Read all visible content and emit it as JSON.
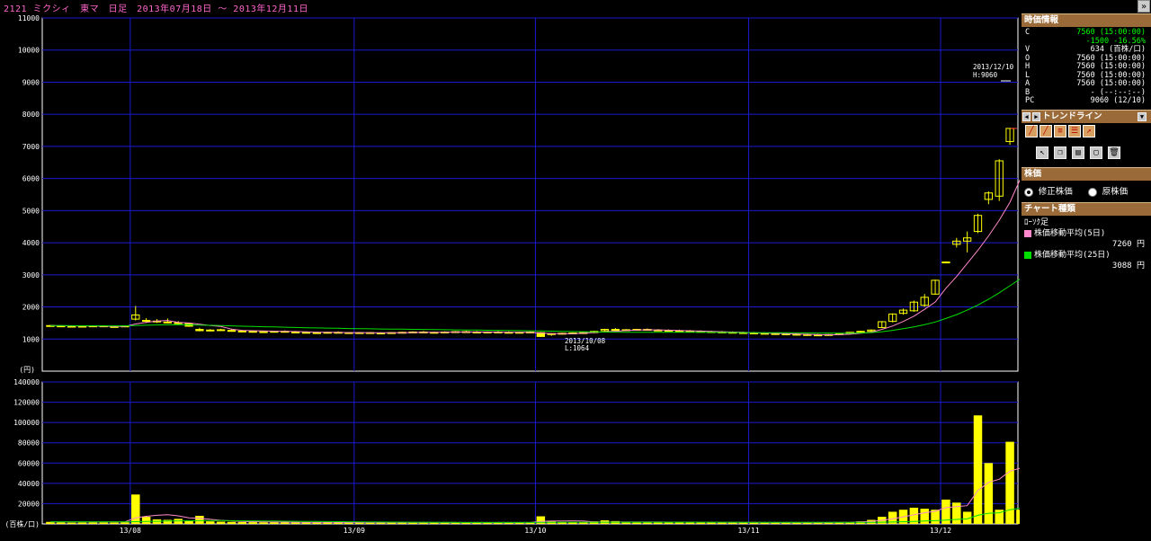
{
  "header": {
    "title": "2121 ミクシィ　東マ　日足　2013年07月18日 ～ 2013年12月11日",
    "collapse_icon": "double-chevron-right-icon"
  },
  "annotations": {
    "high_label_date": "2013/12/10",
    "high_label_value": "H:9060",
    "low_label_date": "2013/10/08",
    "low_label_value": "L:1064"
  },
  "price_axis": {
    "unit_label": "(円)"
  },
  "volume_axis": {
    "unit_label": "(百株/口)"
  },
  "colors": {
    "grid": "#1a1ad0",
    "axis": "#ffffff",
    "candle": "#ffff00",
    "ma5": "#ff88cc",
    "ma25": "#00e000",
    "panel_header": "#9a6a38",
    "price_up_text": "#00ff00"
  },
  "side_panel": {
    "quote_title": "時価情報",
    "quote_rows": [
      {
        "key": "C",
        "value": "7560 (15:00:00)"
      },
      {
        "key": "",
        "value": "-1500 -16.56%"
      },
      {
        "key": "V",
        "value": "634 (百株/口)"
      },
      {
        "key": "O",
        "value": "7560 (15:00:00)"
      },
      {
        "key": "H",
        "value": "7560 (15:00:00)"
      },
      {
        "key": "L",
        "value": "7560 (15:00:00)"
      },
      {
        "key": "A",
        "value": "7560 (15:00:00)"
      },
      {
        "key": "B",
        "value": "- (--:--:--)"
      },
      {
        "key": "PC",
        "value": "9060 (12/10)"
      }
    ],
    "trendline_title": "トレンドライン",
    "stock_price_title": "株価",
    "adjusted_label": "修正株価",
    "original_label": "原株価",
    "chart_type_title": "チャート種類",
    "chart_type_value": "ﾛｰｿｸ足",
    "ma5_label": "株価移動平均(5日)",
    "ma5_value": "7260 円",
    "ma25_label": "株価移動平均(25日)",
    "ma25_value": "3088 円"
  },
  "chart_data": [
    {
      "type": "candlestick",
      "title": "2121 ミクシィ　東マ　日足　2013年07月18日 ～ 2013年12月11日",
      "ylabel": "(円)",
      "ylim": [
        0,
        11000
      ],
      "y_ticks": [
        1000,
        2000,
        3000,
        4000,
        5000,
        6000,
        7000,
        8000,
        9000,
        10000,
        11000
      ],
      "x_tick_labels": [
        "13/08",
        "13/09",
        "13/10",
        "13/11",
        "13/12"
      ],
      "x_tick_index": [
        8,
        29,
        46,
        66,
        84
      ],
      "grid": true,
      "ohlc": [
        [
          1420,
          1440,
          1400,
          1420
        ],
        [
          1410,
          1430,
          1390,
          1400
        ],
        [
          1400,
          1420,
          1380,
          1390
        ],
        [
          1390,
          1410,
          1370,
          1400
        ],
        [
          1400,
          1420,
          1380,
          1410
        ],
        [
          1410,
          1430,
          1380,
          1390
        ],
        [
          1390,
          1410,
          1370,
          1380
        ],
        [
          1380,
          1420,
          1370,
          1410
        ],
        [
          1620,
          2030,
          1580,
          1750
        ],
        [
          1560,
          1650,
          1500,
          1580
        ],
        [
          1540,
          1620,
          1500,
          1560
        ],
        [
          1520,
          1640,
          1490,
          1530
        ],
        [
          1510,
          1560,
          1430,
          1480
        ],
        [
          1480,
          1500,
          1380,
          1400
        ],
        [
          1300,
          1350,
          1240,
          1260
        ],
        [
          1270,
          1310,
          1240,
          1280
        ],
        [
          1290,
          1320,
          1250,
          1270
        ],
        [
          1270,
          1300,
          1230,
          1240
        ],
        [
          1240,
          1280,
          1210,
          1250
        ],
        [
          1240,
          1270,
          1200,
          1220
        ],
        [
          1220,
          1260,
          1190,
          1230
        ],
        [
          1230,
          1260,
          1200,
          1240
        ],
        [
          1240,
          1270,
          1210,
          1220
        ],
        [
          1220,
          1250,
          1190,
          1210
        ],
        [
          1210,
          1240,
          1180,
          1200
        ],
        [
          1200,
          1230,
          1170,
          1190
        ],
        [
          1190,
          1230,
          1170,
          1210
        ],
        [
          1210,
          1240,
          1180,
          1200
        ],
        [
          1200,
          1220,
          1170,
          1190
        ],
        [
          1190,
          1220,
          1170,
          1200
        ],
        [
          1200,
          1220,
          1170,
          1180
        ],
        [
          1180,
          1210,
          1160,
          1190
        ],
        [
          1190,
          1220,
          1170,
          1200
        ],
        [
          1200,
          1230,
          1180,
          1210
        ],
        [
          1210,
          1240,
          1190,
          1220
        ],
        [
          1220,
          1250,
          1190,
          1200
        ],
        [
          1200,
          1230,
          1180,
          1210
        ],
        [
          1210,
          1240,
          1190,
          1220
        ],
        [
          1220,
          1250,
          1200,
          1230
        ],
        [
          1230,
          1260,
          1200,
          1220
        ],
        [
          1220,
          1250,
          1190,
          1210
        ],
        [
          1210,
          1240,
          1190,
          1220
        ],
        [
          1220,
          1250,
          1200,
          1210
        ],
        [
          1210,
          1240,
          1180,
          1200
        ],
        [
          1200,
          1230,
          1180,
          1210
        ],
        [
          1210,
          1240,
          1190,
          1220
        ],
        [
          1200,
          1220,
          1064,
          1080
        ],
        [
          1140,
          1190,
          1100,
          1170
        ],
        [
          1170,
          1200,
          1140,
          1180
        ],
        [
          1180,
          1210,
          1150,
          1190
        ],
        [
          1190,
          1220,
          1160,
          1200
        ],
        [
          1200,
          1260,
          1180,
          1240
        ],
        [
          1260,
          1320,
          1240,
          1300
        ],
        [
          1300,
          1340,
          1260,
          1280
        ],
        [
          1280,
          1310,
          1250,
          1290
        ],
        [
          1290,
          1320,
          1260,
          1300
        ],
        [
          1300,
          1330,
          1260,
          1280
        ],
        [
          1280,
          1310,
          1250,
          1270
        ],
        [
          1270,
          1300,
          1240,
          1260
        ],
        [
          1260,
          1290,
          1230,
          1250
        ],
        [
          1250,
          1280,
          1220,
          1240
        ],
        [
          1240,
          1270,
          1210,
          1230
        ],
        [
          1230,
          1260,
          1200,
          1220
        ],
        [
          1220,
          1250,
          1190,
          1210
        ],
        [
          1210,
          1240,
          1180,
          1200
        ],
        [
          1200,
          1230,
          1170,
          1190
        ],
        [
          1190,
          1220,
          1160,
          1180
        ],
        [
          1180,
          1210,
          1150,
          1170
        ],
        [
          1170,
          1200,
          1130,
          1160
        ],
        [
          1160,
          1190,
          1120,
          1150
        ],
        [
          1150,
          1180,
          1110,
          1140
        ],
        [
          1140,
          1170,
          1100,
          1130
        ],
        [
          1130,
          1160,
          1090,
          1120
        ],
        [
          1120,
          1150,
          1100,
          1140
        ],
        [
          1140,
          1180,
          1120,
          1170
        ],
        [
          1170,
          1220,
          1150,
          1210
        ],
        [
          1210,
          1260,
          1180,
          1240
        ],
        [
          1240,
          1300,
          1200,
          1280
        ],
        [
          1360,
          1560,
          1340,
          1540
        ],
        [
          1550,
          1800,
          1520,
          1780
        ],
        [
          1800,
          1950,
          1760,
          1900
        ],
        [
          1880,
          2200,
          1850,
          2150
        ],
        [
          2050,
          2400,
          2000,
          2300
        ],
        [
          2400,
          2850,
          2380,
          2830
        ],
        [
          3380,
          3420,
          3360,
          3400
        ],
        [
          3950,
          4150,
          3850,
          4050
        ],
        [
          4050,
          4350,
          3700,
          4150
        ],
        [
          4350,
          4900,
          4300,
          4850
        ],
        [
          5350,
          5600,
          5200,
          5550
        ],
        [
          5450,
          6600,
          5300,
          6550
        ],
        [
          7150,
          7550,
          7050,
          7560
        ]
      ],
      "ma5": [
        1420,
        1415,
        1410,
        1405,
        1405,
        1400,
        1395,
        1395,
        1470,
        1520,
        1560,
        1580,
        1520,
        1500,
        1460,
        1420,
        1390,
        1310,
        1270,
        1260,
        1250,
        1245,
        1240,
        1235,
        1225,
        1215,
        1210,
        1205,
        1200,
        1200,
        1198,
        1196,
        1196,
        1198,
        1204,
        1206,
        1208,
        1212,
        1218,
        1220,
        1220,
        1218,
        1216,
        1212,
        1210,
        1212,
        1186,
        1174,
        1168,
        1164,
        1182,
        1204,
        1222,
        1242,
        1262,
        1282,
        1288,
        1286,
        1276,
        1268,
        1258,
        1248,
        1238,
        1228,
        1218,
        1208,
        1198,
        1188,
        1178,
        1168,
        1158,
        1148,
        1138,
        1132,
        1136,
        1150,
        1178,
        1212,
        1302,
        1404,
        1548,
        1714,
        1926,
        2154,
        2580,
        2946,
        3352,
        3766,
        4212,
        4700,
        5260,
        6000,
        7260
      ],
      "ma25": [
        1420,
        1418,
        1416,
        1414,
        1413,
        1412,
        1411,
        1410,
        1420,
        1430,
        1440,
        1445,
        1446,
        1442,
        1436,
        1428,
        1420,
        1410,
        1400,
        1392,
        1384,
        1376,
        1368,
        1360,
        1352,
        1346,
        1340,
        1334,
        1328,
        1322,
        1318,
        1314,
        1310,
        1306,
        1302,
        1298,
        1294,
        1290,
        1286,
        1282,
        1278,
        1274,
        1270,
        1266,
        1262,
        1258,
        1252,
        1246,
        1240,
        1234,
        1228,
        1222,
        1218,
        1214,
        1212,
        1210,
        1210,
        1210,
        1210,
        1210,
        1210,
        1210,
        1208,
        1206,
        1204,
        1202,
        1200,
        1198,
        1196,
        1194,
        1192,
        1190,
        1188,
        1186,
        1184,
        1182,
        1190,
        1200,
        1230,
        1270,
        1320,
        1380,
        1450,
        1530,
        1640,
        1760,
        1900,
        2060,
        2240,
        2440,
        2660,
        2880,
        3088
      ]
    },
    {
      "type": "bar",
      "ylabel": "(百株/口)",
      "ylim": [
        0,
        140000
      ],
      "y_ticks": [
        20000,
        40000,
        60000,
        80000,
        100000,
        120000,
        140000
      ],
      "x_tick_labels": [
        "13/08",
        "13/09",
        "13/10",
        "13/11",
        "13/12"
      ],
      "grid": true,
      "values": [
        2000,
        1500,
        1200,
        1300,
        1500,
        1400,
        1300,
        1600,
        29000,
        7000,
        4500,
        4000,
        5000,
        3500,
        8000,
        2500,
        2200,
        2000,
        1800,
        1700,
        1600,
        1700,
        1500,
        1400,
        1500,
        1300,
        1400,
        1500,
        1300,
        1400,
        1200,
        1300,
        1400,
        1300,
        1200,
        1300,
        1400,
        1300,
        1200,
        1300,
        1400,
        1300,
        1200,
        1300,
        1400,
        1300,
        7500,
        2500,
        1800,
        1600,
        1800,
        2500,
        3500,
        2800,
        2200,
        2000,
        1900,
        1800,
        1700,
        1600,
        1500,
        1400,
        1500,
        1400,
        1300,
        1400,
        1300,
        1200,
        1300,
        1400,
        1300,
        1200,
        1300,
        1400,
        1500,
        1700,
        2500,
        4000,
        7000,
        12000,
        14000,
        16000,
        15000,
        14000,
        24000,
        21000,
        12000,
        107000,
        60000,
        14000,
        81000,
        14000,
        2000
      ],
      "ma_line": [
        2000,
        2000,
        2000,
        2000,
        2000,
        2000,
        2000,
        2000,
        6000,
        7500,
        8500,
        9000,
        8000,
        6000,
        5500,
        4500,
        3500,
        3000,
        2500,
        2200,
        2000,
        1900,
        1800,
        1700,
        1600,
        1500,
        1500,
        1500,
        1400,
        1400,
        1400,
        1400,
        1400,
        1400,
        1400,
        1400,
        1400,
        1400,
        1400,
        1400,
        1400,
        1400,
        1400,
        1400,
        1400,
        1400,
        2500,
        2800,
        2900,
        3000,
        2800,
        2000,
        1900,
        1900,
        1900,
        1900,
        1900,
        1900,
        1800,
        1800,
        1800,
        1700,
        1700,
        1600,
        1600,
        1500,
        1500,
        1400,
        1400,
        1400,
        1400,
        1400,
        1400,
        1400,
        1500,
        1600,
        2000,
        2600,
        3500,
        5000,
        7000,
        9000,
        11000,
        12500,
        16000,
        17000,
        18000,
        33000,
        41000,
        44000,
        52000,
        55000,
        22000
      ],
      "ma_line2": [
        2000,
        2000,
        2000,
        2000,
        2000,
        2000,
        2000,
        2000,
        2200,
        2400,
        2600,
        2800,
        3000,
        3100,
        3200,
        3300,
        3300,
        3200,
        3100,
        3000,
        2900,
        2800,
        2700,
        2600,
        2500,
        2400,
        2300,
        2200,
        2100,
        2000,
        1900,
        1850,
        1800,
        1750,
        1700,
        1650,
        1600,
        1550,
        1500,
        1450,
        1400,
        1400,
        1400,
        1400,
        1400,
        1400,
        1500,
        1600,
        1650,
        1700,
        1700,
        1700,
        1700,
        1700,
        1700,
        1700,
        1700,
        1700,
        1700,
        1700,
        1700,
        1700,
        1700,
        1700,
        1650,
        1600,
        1600,
        1600,
        1550,
        1550,
        1500,
        1500,
        1500,
        1500,
        1500,
        1500,
        1550,
        1600,
        1700,
        1900,
        2100,
        2400,
        2800,
        3200,
        3800,
        4400,
        5000,
        8500,
        10500,
        11000,
        14000,
        15500,
        16000
      ]
    }
  ]
}
